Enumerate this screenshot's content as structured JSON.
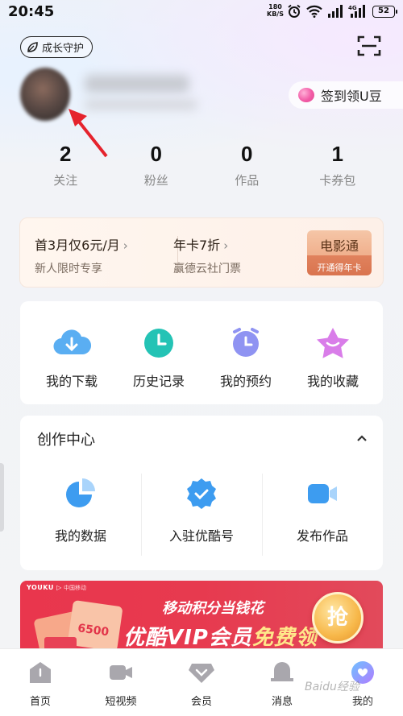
{
  "status_bar": {
    "time": "20:45",
    "net_speed_value": "180",
    "net_speed_unit": "KB/S",
    "network": "4G",
    "battery": "52"
  },
  "header": {
    "growth_badge": "成长守护",
    "checkin_label": "签到领U豆"
  },
  "stats": [
    {
      "value": "2",
      "label": "关注"
    },
    {
      "value": "0",
      "label": "粉丝"
    },
    {
      "value": "0",
      "label": "作品"
    },
    {
      "value": "1",
      "label": "卡券包"
    }
  ],
  "vip": {
    "offer1_title": "首3月仅6元/月",
    "offer1_sub": "新人限时专享",
    "offer2_title": "年卡7折",
    "offer2_sub": "赢德云社门票",
    "movie_title": "电影通",
    "movie_sub": "开通得年卡",
    "chevron": "›"
  },
  "quick_actions": [
    {
      "label": "我的下载",
      "icon": "cloud-download-icon",
      "color": "#4aa3f0"
    },
    {
      "label": "历史记录",
      "icon": "clock-icon",
      "color": "#22c3b6"
    },
    {
      "label": "我的预约",
      "icon": "alarm-clock-icon",
      "color": "#8b8ff0"
    },
    {
      "label": "我的收藏",
      "icon": "star-icon",
      "color": "#d57be8"
    }
  ],
  "creator_center": {
    "title": "创作中心",
    "items": [
      {
        "label": "我的数据",
        "icon": "pie-chart-icon"
      },
      {
        "label": "入驻优酷号",
        "icon": "verified-badge-icon"
      },
      {
        "label": "发布作品",
        "icon": "video-camera-icon"
      }
    ]
  },
  "banner": {
    "brand": "YOUKU ▷",
    "partner": "中国移动",
    "line1": "移动积分当钱花",
    "line2_prefix": "优酷VIP会员",
    "line2_highlight": "免费领",
    "button": "抢",
    "coupon_value": "6500"
  },
  "tabbar": [
    {
      "label": "首页",
      "icon": "home-icon"
    },
    {
      "label": "短视频",
      "icon": "short-video-icon"
    },
    {
      "label": "会员",
      "icon": "vip-diamond-icon"
    },
    {
      "label": "消息",
      "icon": "message-bell-icon"
    },
    {
      "label": "我的",
      "icon": "profile-icon"
    }
  ],
  "watermark": "Baidu经验"
}
